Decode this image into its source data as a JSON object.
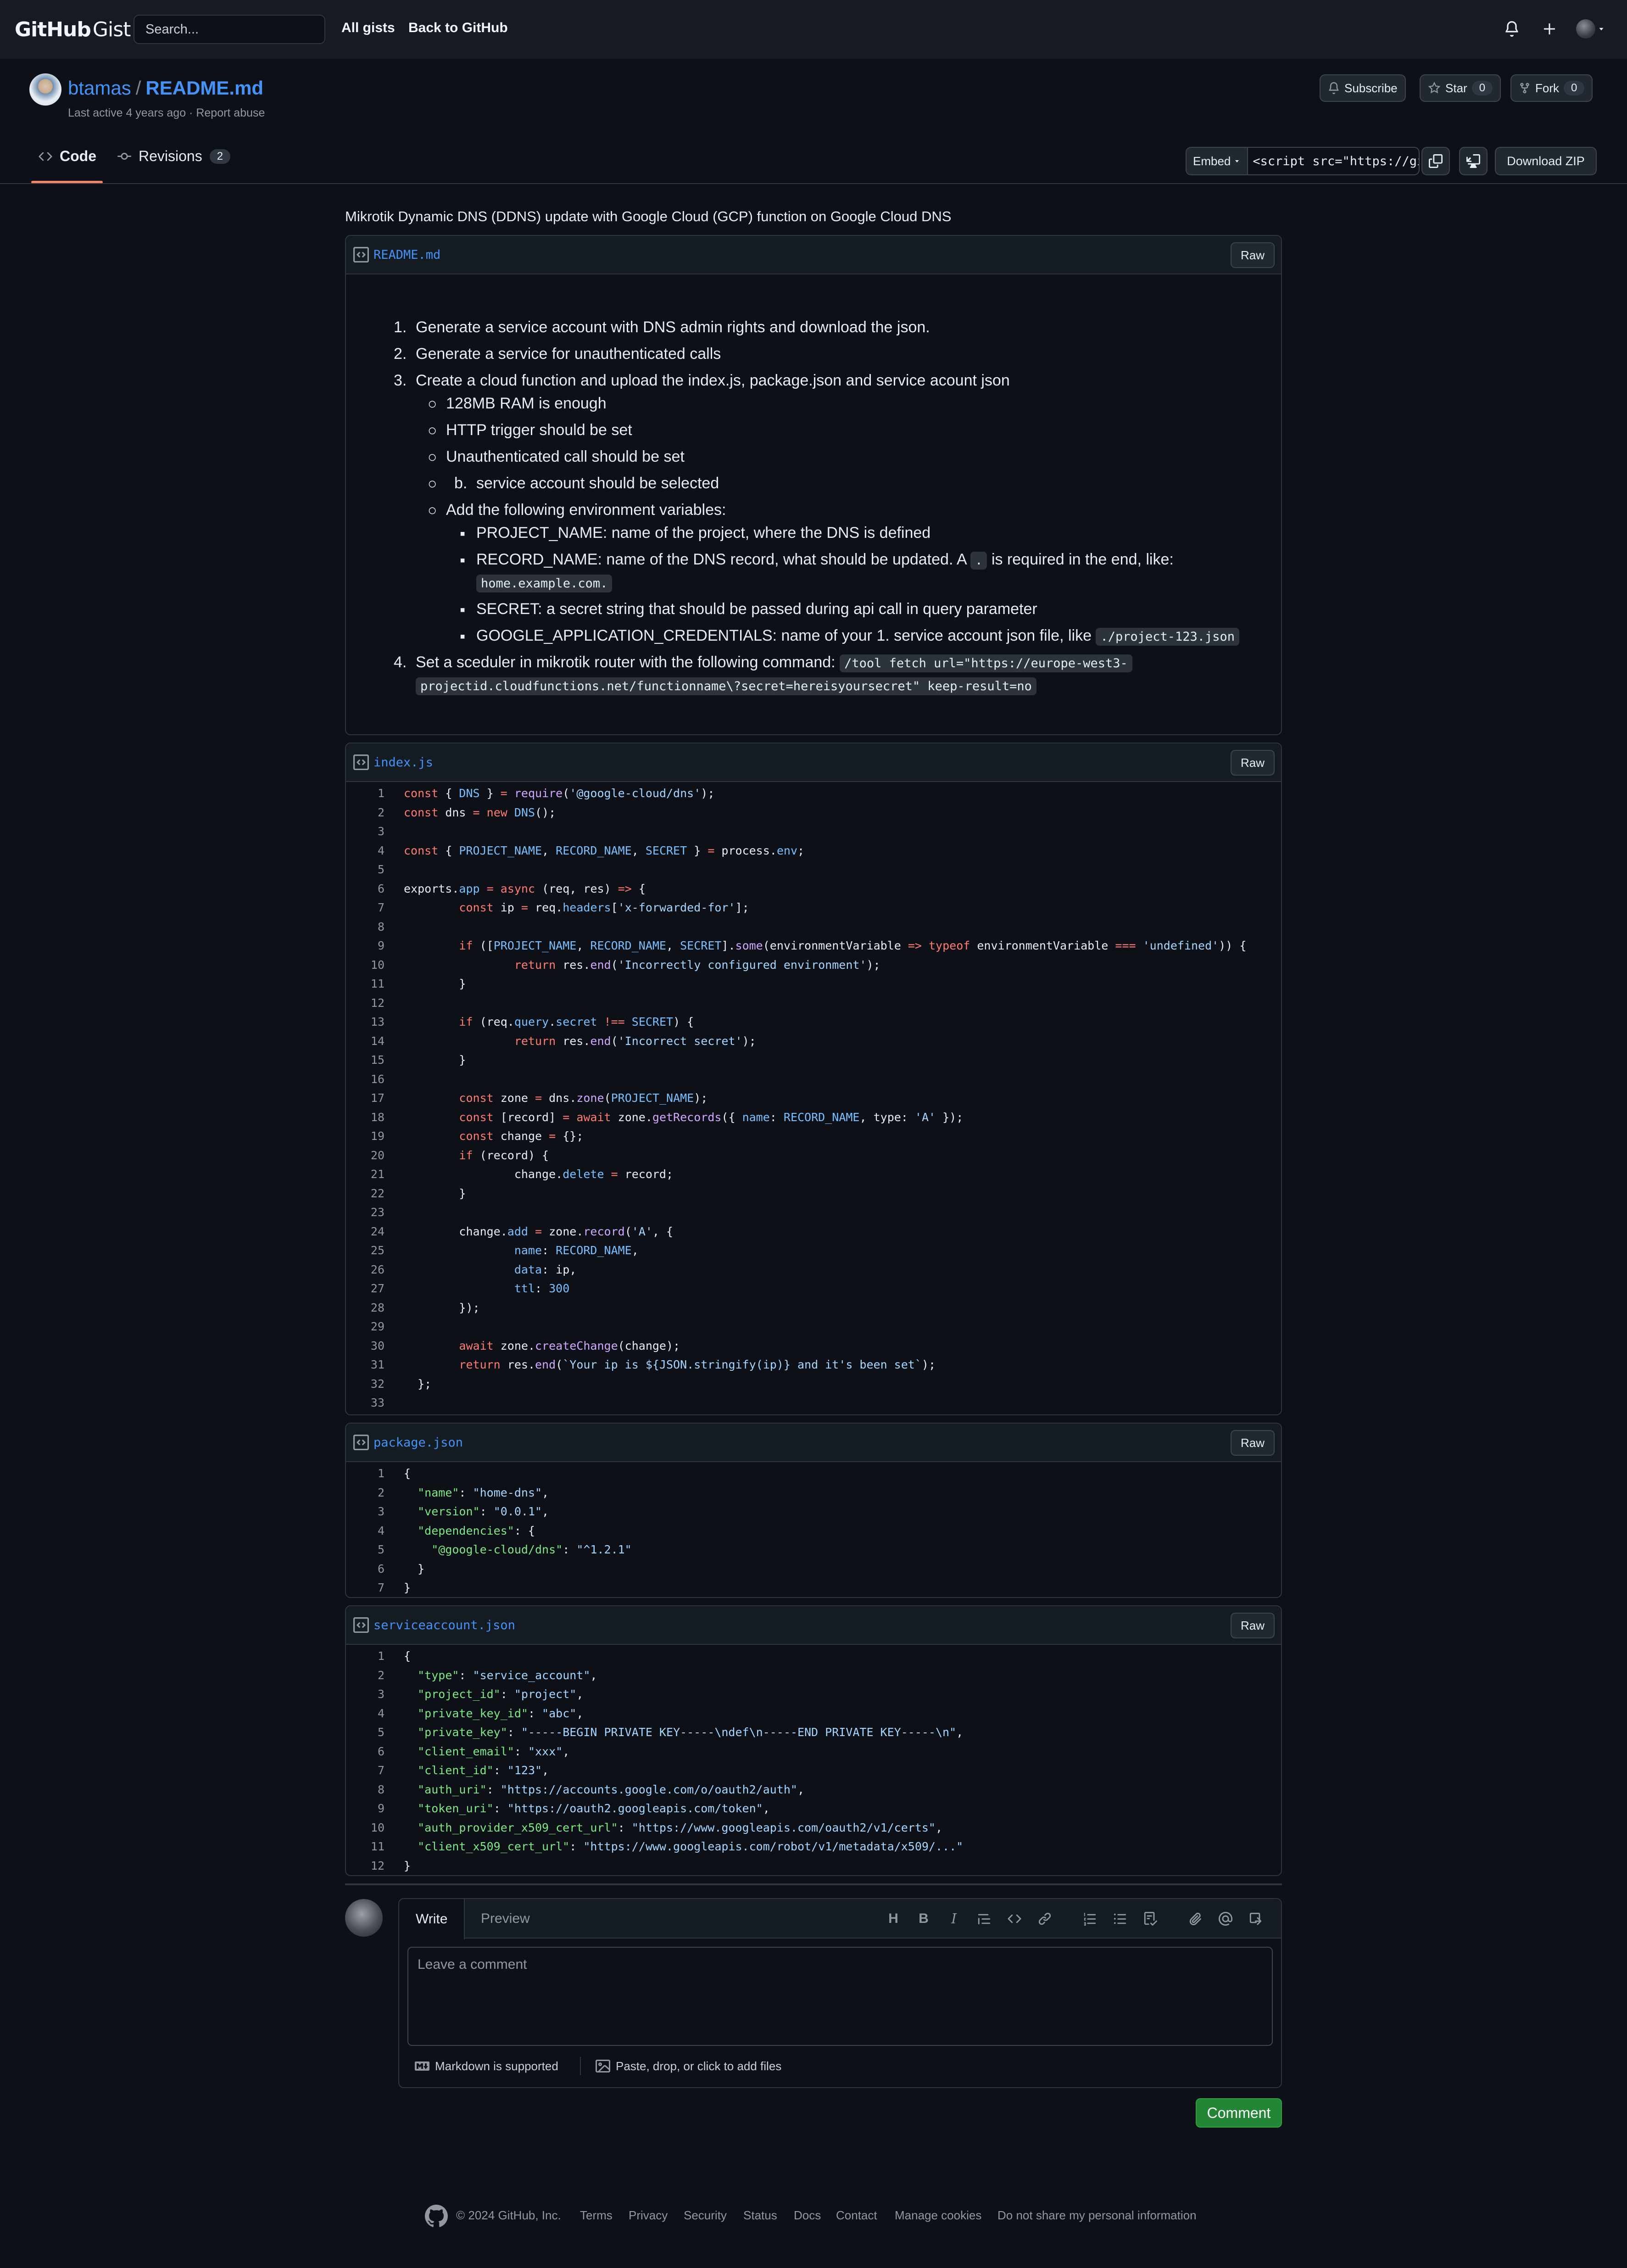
{
  "header": {
    "logo_github": "GitHub",
    "logo_gist": "Gist",
    "search_placeholder": "Search...",
    "nav": [
      "All gists",
      "Back to GitHub"
    ]
  },
  "gist": {
    "owner": "btamas",
    "separator": "/",
    "filename": "README.md",
    "meta_active": "Last active 4 years ago",
    "meta_dot": "·",
    "meta_report": "Report abuse",
    "subscribe": "Subscribe",
    "star": "Star",
    "star_count": "0",
    "fork": "Fork",
    "fork_count": "0"
  },
  "tabs": {
    "code": "Code",
    "revisions": "Revisions",
    "revisions_count": "2"
  },
  "toolbar": {
    "embed_label": "Embed",
    "embed_value": "<script src=\"https://gi",
    "download_zip": "Download ZIP"
  },
  "description": "Mikrotik Dynamic DNS (DDNS) update with Google Cloud (GCP) function on Google Cloud DNS",
  "files": {
    "readme": {
      "name": "README.md",
      "raw": "Raw",
      "items": {
        "n1": "1.",
        "t1": "Generate a service account with DNS admin rights and download the json.",
        "n2": "2.",
        "t2": "Generate a service for unauthenticated calls",
        "n3": "3.",
        "t3": "Create a cloud function and upload the index.js, package.json and service acount json",
        "s1": "128MB RAM is enough",
        "s2": "HTTP trigger should be set",
        "s3": "Unauthenticated call should be set",
        "s4_marker": "b.",
        "s4": "service account should be selected",
        "s5": "Add the following environment variables:",
        "e1": "PROJECT_NAME: name of the project, where the DNS is defined",
        "e2a": "RECORD_NAME: name of the DNS record, what should be updated. A",
        "e2code": ".",
        "e2b": "is required in the end, like:",
        "e2code2": "home.example.com.",
        "e3": "SECRET: a secret string that should be passed during api call in query parameter",
        "e4": "GOOGLE_APPLICATION_CREDENTIALS: name of your 1. service account json file, like",
        "e4code": "./project-123.json",
        "n4": "4.",
        "t4": "Set a sceduler in mikrotik router with the following command:",
        "t4code1": "/tool fetch url=\"https://europe-west3-",
        "t4code2": "projectid.cloudfunctions.net/functionname\\?secret=hereisyoursecret\" keep-result=no"
      }
    },
    "index": {
      "name": "index.js",
      "raw": "Raw",
      "lines": [
        "const { DNS } = require('@google-cloud/dns');",
        "const dns = new DNS();",
        "",
        "const { PROJECT_NAME, RECORD_NAME, SECRET } = process.env;",
        "",
        "exports.app = async (req, res) => {",
        "        const ip = req.headers['x-forwarded-for'];",
        "",
        "        if ([PROJECT_NAME, RECORD_NAME, SECRET].some(environmentVariable => typeof environmentVariable === 'undefined')) {",
        "                return res.end('Incorrectly configured environment');",
        "        }",
        "",
        "        if (req.query.secret !== SECRET) {",
        "                return res.end('Incorrect secret');",
        "        }",
        "",
        "        const zone = dns.zone(PROJECT_NAME);",
        "        const [record] = await zone.getRecords({ name: RECORD_NAME, type: 'A' });",
        "        const change = {};",
        "        if (record) {",
        "                change.delete = record;",
        "        }",
        "",
        "        change.add = zone.record('A', {",
        "                name: RECORD_NAME,",
        "                data: ip,",
        "                ttl: 300",
        "        });",
        "",
        "        await zone.createChange(change);",
        "        return res.end(`Your ip is ${JSON.stringify(ip)} and it's been set`);",
        "  };",
        ""
      ]
    },
    "package": {
      "name": "package.json",
      "raw": "Raw",
      "lines": [
        "{",
        "  \"name\": \"home-dns\",",
        "  \"version\": \"0.0.1\",",
        "  \"dependencies\": {",
        "    \"@google-cloud/dns\": \"^1.2.1\"",
        "  }",
        "}"
      ]
    },
    "service": {
      "name": "serviceaccount.json",
      "raw": "Raw",
      "lines": [
        "{",
        "  \"type\": \"service_account\",",
        "  \"project_id\": \"project\",",
        "  \"private_key_id\": \"abc\",",
        "  \"private_key\": \"-----BEGIN PRIVATE KEY-----\\ndef\\n-----END PRIVATE KEY-----\\n\",",
        "  \"client_email\": \"xxx\",",
        "  \"client_id\": \"123\",",
        "  \"auth_uri\": \"https://accounts.google.com/o/oauth2/auth\",",
        "  \"token_uri\": \"https://oauth2.googleapis.com/token\",",
        "  \"auth_provider_x509_cert_url\": \"https://www.googleapis.com/oauth2/v1/certs\",",
        "  \"client_x509_cert_url\": \"https://www.googleapis.com/robot/v1/metadata/x509/...\"",
        "}"
      ]
    }
  },
  "comment": {
    "tab_write": "Write",
    "tab_preview": "Preview",
    "placeholder": "Leave a comment",
    "markdown_note": "Markdown is supported",
    "attach_note": "Paste, drop, or click to add files",
    "submit": "Comment"
  },
  "footer": {
    "copyright": "© 2024 GitHub, Inc.",
    "links": [
      "Terms",
      "Privacy",
      "Security",
      "Status",
      "Docs",
      "Contact",
      "Manage cookies",
      "Do not share my personal information"
    ]
  },
  "colors": {
    "background": "#0d1117",
    "header": "#161b22",
    "link": "#4493f8",
    "tab_underline": "#f78166",
    "comment_button": "#238636"
  }
}
